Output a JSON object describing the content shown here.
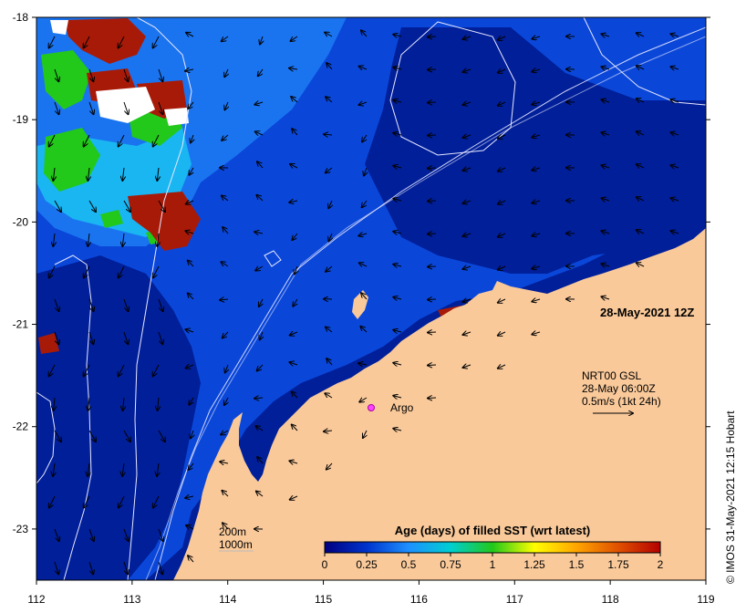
{
  "map": {
    "lon_range": [
      112,
      119
    ],
    "lat_range": [
      -18,
      -23.5
    ],
    "lon_ticks": [
      "112",
      "113",
      "114",
      "115",
      "116",
      "117",
      "118",
      "119"
    ],
    "lat_ticks": [
      "-18",
      "-19",
      "-20",
      "-21",
      "-22",
      "-23"
    ],
    "colors": {
      "land": "#f9c99a",
      "deep": "#001f99",
      "mid": "#0a47d9",
      "shallow": "#1a74f0",
      "cyan": "#19b6f2",
      "green": "#22c81a",
      "red": "#a81a08",
      "white": "#ffffff"
    }
  },
  "labels": {
    "date": "28-May-2021 12Z",
    "argo": "Argo",
    "current_source": "NRT00 GSL",
    "current_time": "28-May 06:00Z",
    "current_scale": "0.5m/s (1kt 24h)",
    "isobath_200": "200m",
    "isobath_1000": "1000m",
    "colorbar_title": "Age (days) of filled SST (wrt latest)",
    "credit": "© IMOS 31-May-2021 12:15 Hobart"
  },
  "colorbar": {
    "ticks": [
      "0",
      "0.25",
      "0.5",
      "0.75",
      "1",
      "1.25",
      "1.5",
      "1.75",
      "2"
    ],
    "stops": [
      "#000080",
      "#0033cc",
      "#1e90ff",
      "#00ced1",
      "#22c81a",
      "#ffff00",
      "#ffa500",
      "#e05000",
      "#b40000"
    ]
  }
}
